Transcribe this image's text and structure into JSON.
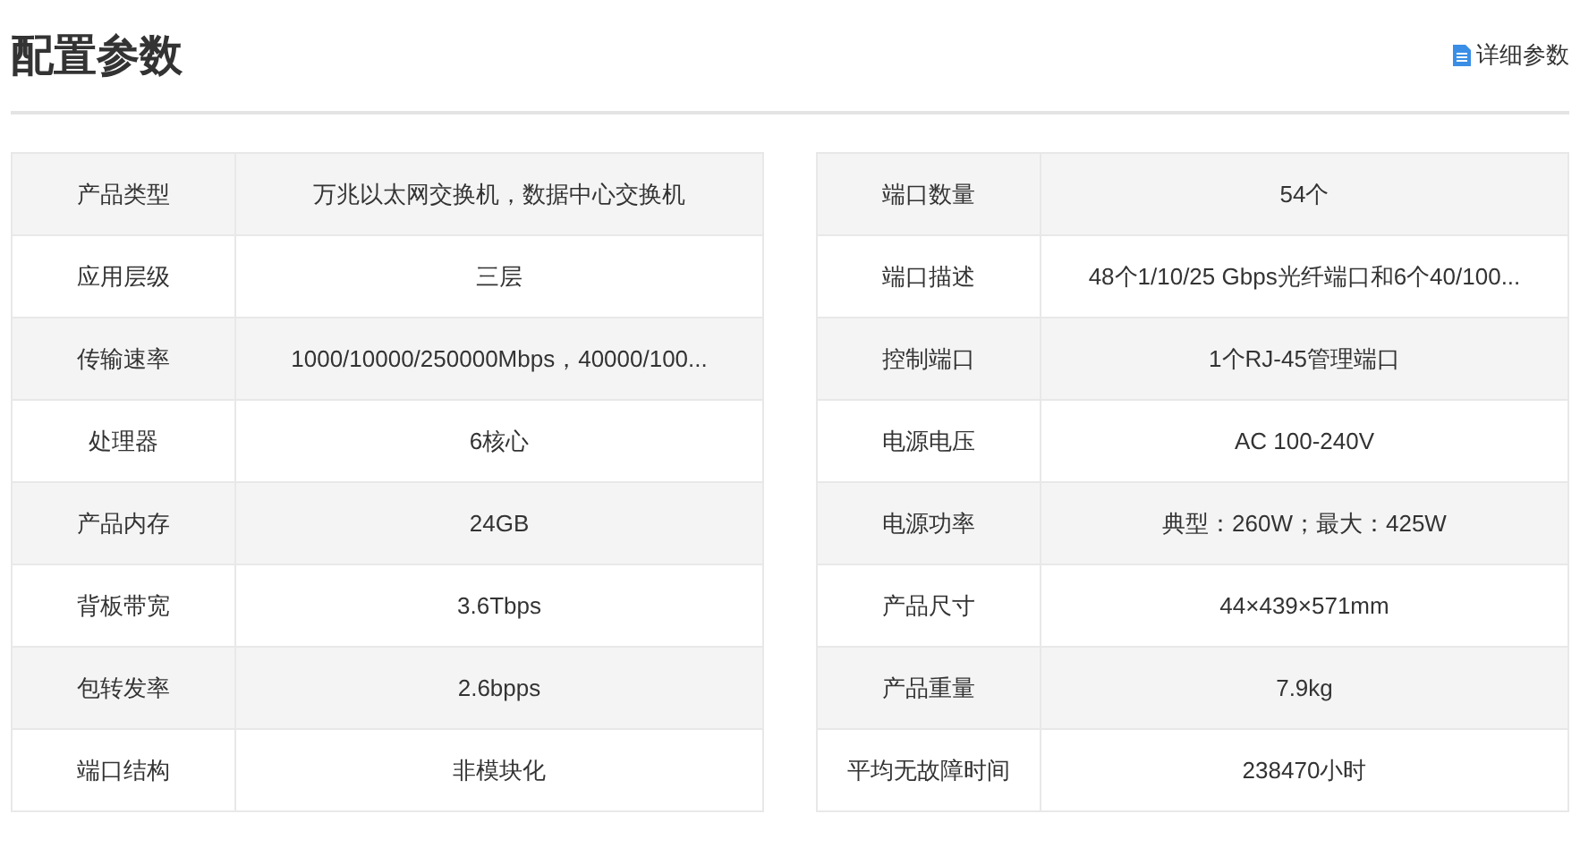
{
  "header": {
    "title": "配置参数",
    "link": "详细参数"
  },
  "tables": [
    {
      "rows": [
        {
          "label": "产品类型",
          "value": "万兆以太网交换机，数据中心交换机"
        },
        {
          "label": "应用层级",
          "value": "三层"
        },
        {
          "label": "传输速率",
          "value": "1000/10000/250000Mbps，40000/100..."
        },
        {
          "label": "处理器",
          "value": "6核心"
        },
        {
          "label": "产品内存",
          "value": "24GB"
        },
        {
          "label": "背板带宽",
          "value": "3.6Tbps"
        },
        {
          "label": "包转发率",
          "value": "2.6bpps"
        },
        {
          "label": "端口结构",
          "value": "非模块化"
        }
      ]
    },
    {
      "rows": [
        {
          "label": "端口数量",
          "value": "54个"
        },
        {
          "label": "端口描述",
          "value": "48个1/10/25 Gbps光纤端口和6个40/100..."
        },
        {
          "label": "控制端口",
          "value": "1个RJ-45管理端口"
        },
        {
          "label": "电源电压",
          "value": "AC 100-240V"
        },
        {
          "label": "电源功率",
          "value": "典型：260W；最大：425W"
        },
        {
          "label": "产品尺寸",
          "value": "44×439×571mm"
        },
        {
          "label": "产品重量",
          "value": "7.9kg"
        },
        {
          "label": "平均无故障时间",
          "value": "238470小时"
        }
      ]
    }
  ]
}
